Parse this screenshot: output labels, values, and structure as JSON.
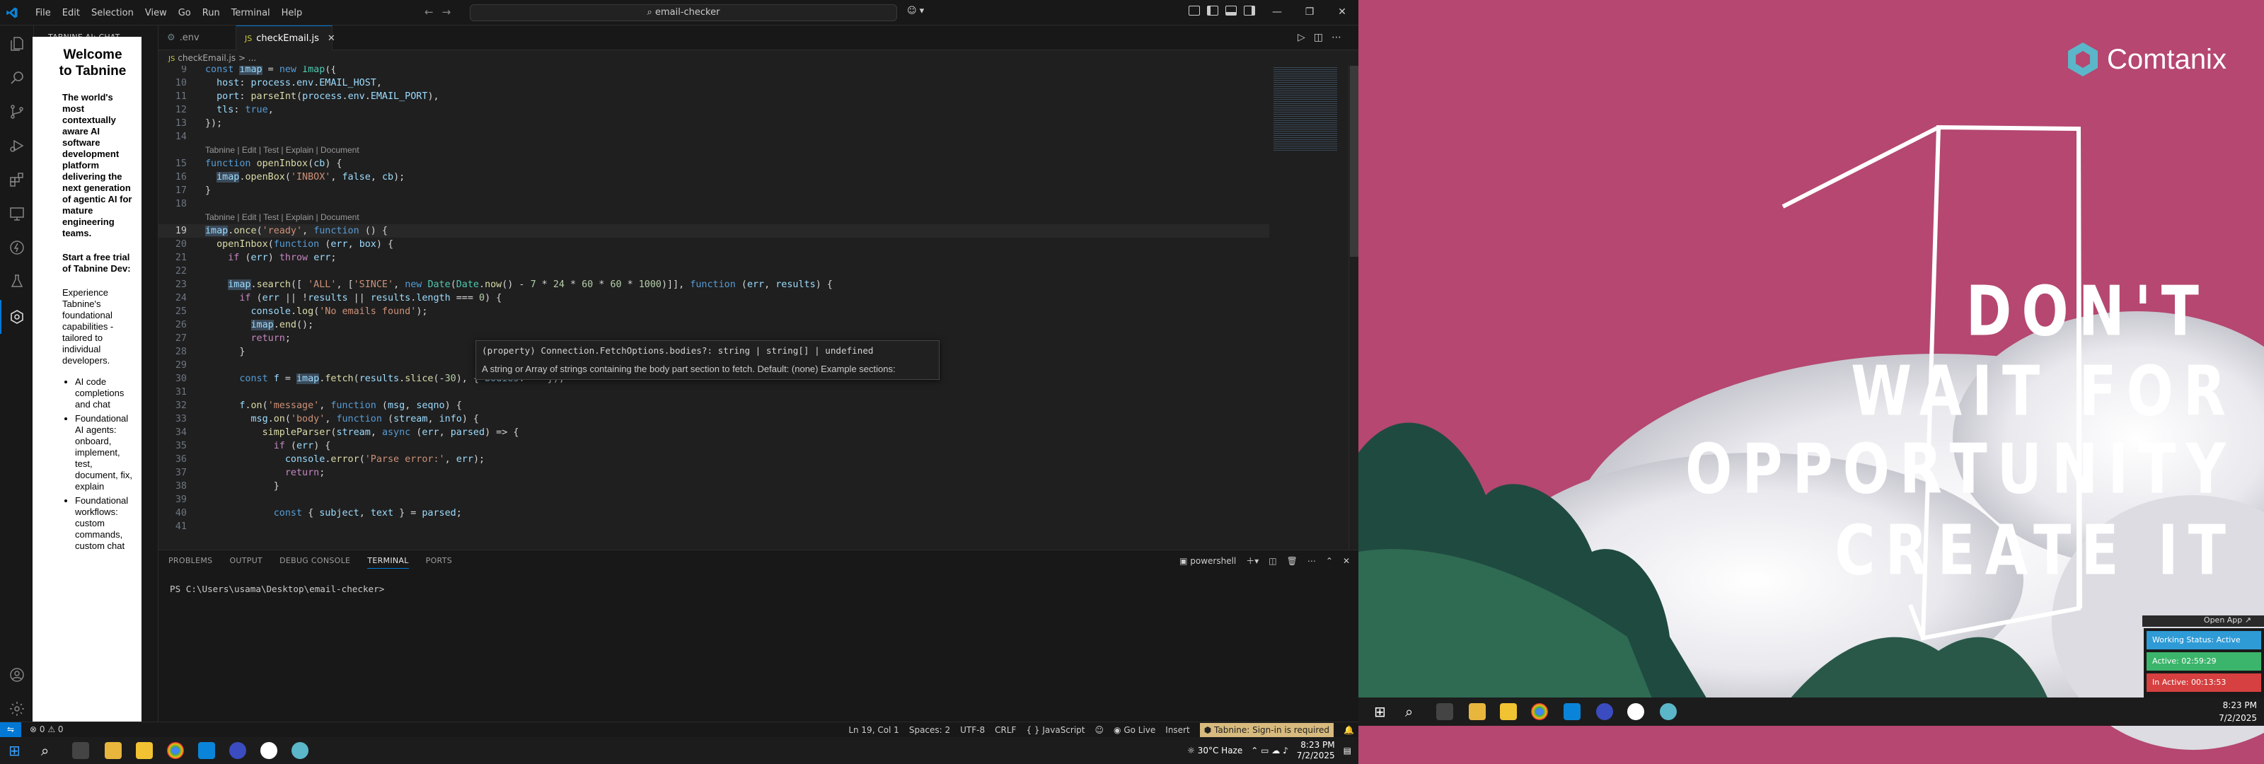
{
  "menu": [
    "File",
    "Edit",
    "Selection",
    "View",
    "Go",
    "Run",
    "Terminal",
    "Help"
  ],
  "command_center": "email-checker",
  "sidebar": {
    "title": "TABNINE AI: CHAT",
    "welcome": "Welcome to Tabnine",
    "tagline": "The world's most contextually aware AI software development platform delivering the next generation of agentic AI for mature engineering teams.",
    "trial": "Start a free trial of Tabnine Dev:",
    "experience": "Experience Tabnine's foundational capabilities - tailored to individual developers.",
    "bullets": [
      "AI code completions and chat",
      "Foundational AI agents: onboard, implement, test, document, fix, explain",
      "Foundational workflows: custom commands, custom chat"
    ]
  },
  "tabs": [
    {
      "label": ".env",
      "icon": "gear-icon"
    },
    {
      "label": "checkEmail.js",
      "icon": "js-icon",
      "active": true
    }
  ],
  "breadcrumb": "checkEmail.js > ...",
  "codelens": "Tabnine | Edit | Test | Explain | Document",
  "code": [
    {
      "n": "9",
      "t": "const imap = new Imap({"
    },
    {
      "n": "10",
      "t": "  host: process.env.EMAIL_HOST,"
    },
    {
      "n": "11",
      "t": "  port: parseInt(process.env.EMAIL_PORT),"
    },
    {
      "n": "12",
      "t": "  tls: true,"
    },
    {
      "n": "13",
      "t": "});"
    },
    {
      "n": "14",
      "t": ""
    },
    {
      "n": "15",
      "t": "function openInbox(cb) {"
    },
    {
      "n": "16",
      "t": "  imap.openBox('INBOX', false, cb);"
    },
    {
      "n": "17",
      "t": "}"
    },
    {
      "n": "18",
      "t": ""
    },
    {
      "n": "19",
      "t": "imap.once('ready', function () {"
    },
    {
      "n": "20",
      "t": "  openInbox(function (err, box) {"
    },
    {
      "n": "21",
      "t": "    if (err) throw err;"
    },
    {
      "n": "22",
      "t": ""
    },
    {
      "n": "23",
      "t": "    imap.search([ 'ALL', ['SINCE', new Date(Date.now() - 7 * 24 * 60 * 60 * 1000)]], function (err, results) {"
    },
    {
      "n": "24",
      "t": "      if (err || !results || results.length === 0) {"
    },
    {
      "n": "25",
      "t": "        console.log('No emails found');"
    },
    {
      "n": "26",
      "t": "        imap.end();"
    },
    {
      "n": "27",
      "t": "        return;"
    },
    {
      "n": "28",
      "t": "      }"
    },
    {
      "n": "29",
      "t": ""
    },
    {
      "n": "30",
      "t": "      const f = imap.fetch(results.slice(-30), { bodies: '' });"
    },
    {
      "n": "31",
      "t": ""
    },
    {
      "n": "32",
      "t": "      f.on('message', function (msg, seqno) {"
    },
    {
      "n": "33",
      "t": "        msg.on('body', function (stream, info) {"
    },
    {
      "n": "34",
      "t": "          simpleParser(stream, async (err, parsed) => {"
    },
    {
      "n": "35",
      "t": "            if (err) {"
    },
    {
      "n": "36",
      "t": "              console.error('Parse error:', err);"
    },
    {
      "n": "37",
      "t": "              return;"
    },
    {
      "n": "38",
      "t": "            }"
    },
    {
      "n": "39",
      "t": ""
    },
    {
      "n": "40",
      "t": "            const { subject, text } = parsed;"
    },
    {
      "n": "41",
      "t": ""
    }
  ],
  "hover": {
    "signature": "(property) Connection.FetchOptions.bodies?: string | string[] | undefined",
    "description": "A string or Array of strings containing the body part section to fetch. Default: (none) Example sections:"
  },
  "panel": {
    "tabs": [
      "PROBLEMS",
      "OUTPUT",
      "DEBUG CONSOLE",
      "TERMINAL",
      "PORTS"
    ],
    "active_tab": "TERMINAL",
    "shell": "powershell",
    "prompt": "PS C:\\Users\\usama\\Desktop\\email-checker>"
  },
  "status": {
    "problems": "⊗ 0 ⚠ 0",
    "position": "Ln 19, Col 1",
    "spaces": "Spaces: 2",
    "encoding": "UTF-8",
    "eol": "CRLF",
    "language": "JavaScript",
    "golive": "Go Live",
    "insert": "Insert",
    "tabnine": "Tabnine: Sign-in is required"
  },
  "tray1": {
    "weather": "30°C Haze",
    "time": "8:23 PM",
    "date": "7/2/2025"
  },
  "tray2": {
    "time": "8:23 PM",
    "date": "7/2/2025"
  },
  "wallpaper": {
    "brand": "Comtanix",
    "lines": [
      "DON'T",
      "WAIT FOR",
      "OPPORTUNITY",
      "CREATE IT"
    ]
  },
  "widget": {
    "open_app": "Open App",
    "working": "Working Status: Active",
    "active": "Active: 02:59:29",
    "inactive": "In Active: 00:13:53"
  },
  "colors": {
    "accent": "#0078d4",
    "wallpaper_pink": "#b54770",
    "tabnine_badge": "#d7ba7d"
  }
}
